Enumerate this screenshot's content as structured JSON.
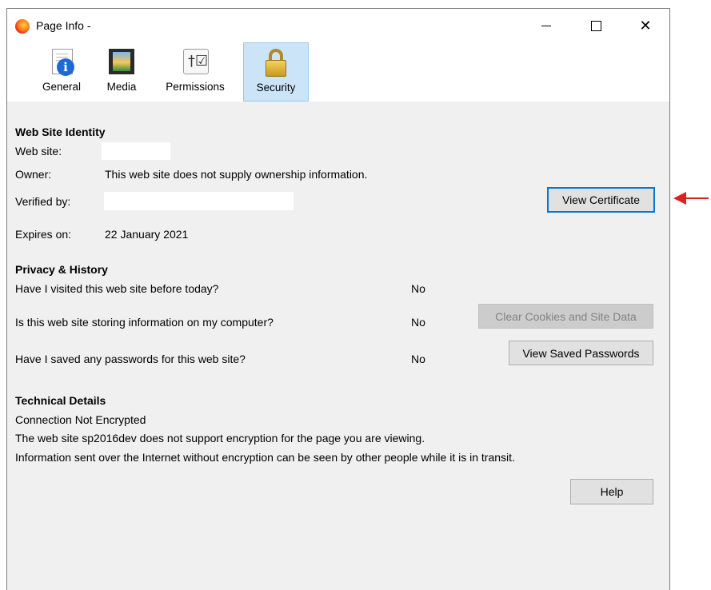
{
  "window": {
    "title": "Page Info -",
    "controls": {
      "minimize": "—",
      "maximize": "",
      "close": "✕"
    }
  },
  "toolbar": {
    "tabs": [
      {
        "label": "General",
        "icon": "info-icon"
      },
      {
        "label": "Media",
        "icon": "media-icon"
      },
      {
        "label": "Permissions",
        "icon": "permissions-icon"
      },
      {
        "label": "Security",
        "icon": "lock-icon",
        "selected": true
      }
    ]
  },
  "identity": {
    "heading": "Web Site Identity",
    "website_label": "Web site:",
    "owner_label": "Owner:",
    "owner_value": "This web site does not supply ownership information.",
    "verified_label": "Verified by:",
    "view_certificate": "View Certificate",
    "expires_label": "Expires on:",
    "expires_value": "22 January 2021"
  },
  "privacy": {
    "heading": "Privacy & History",
    "rows": [
      {
        "question": "Have I visited this web site before today?",
        "answer": "No"
      },
      {
        "question": "Is this web site storing information on my computer?",
        "answer": "No",
        "button": "Clear Cookies and Site Data"
      },
      {
        "question": "Have I saved any passwords for this web site?",
        "answer": "No",
        "button": "View Saved Passwords"
      }
    ]
  },
  "technical": {
    "heading": "Technical Details",
    "line1": "Connection Not Encrypted",
    "line2": "The web site sp2016dev does not support encryption for the page you are viewing.",
    "line3": "Information sent over the Internet without encryption can be seen by other people while it is in transit."
  },
  "help_button": "Help",
  "colors": {
    "arrow": "#e02020",
    "selected_tab": "#cce4f7",
    "focus_border": "#0078d7"
  }
}
